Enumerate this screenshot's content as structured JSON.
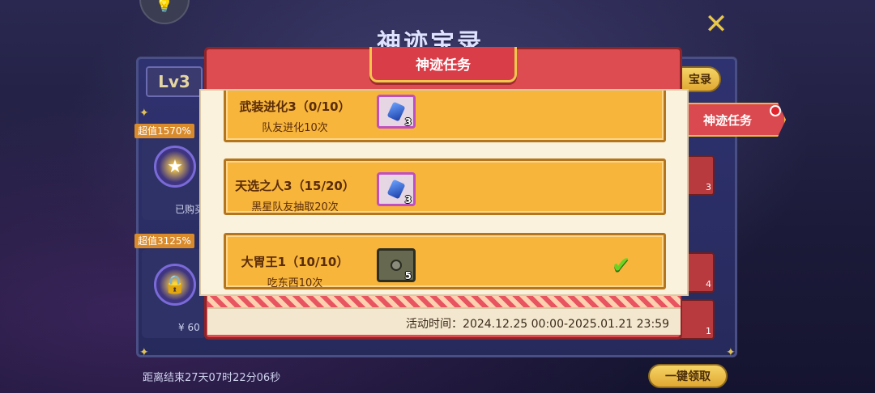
{
  "background": {
    "title": "神迹宝录",
    "level": "Lv3",
    "baolu_button": "宝录",
    "side_items": [
      {
        "badge": "超值1570%",
        "label": "已购买"
      },
      {
        "badge": "超值3125%",
        "label": "¥ 60"
      }
    ],
    "countdown": "距离结束27天07时22分06秒",
    "claim_all": "一键领取",
    "right_tab": "神迹任务",
    "right_slots": [
      "3",
      "4",
      "1"
    ]
  },
  "modal": {
    "title": "神迹任务",
    "tasks": [
      {
        "name": "武装进化3（0/10）",
        "desc": "队友进化10次",
        "reward_icon": "blue-gem-icon",
        "reward_count": "3",
        "completed": false
      },
      {
        "name": "天选之人3（15/20）",
        "desc": "黑星队友抽取20次",
        "reward_icon": "blue-gem-icon",
        "reward_count": "3",
        "completed": false
      },
      {
        "name": "大胃王1（10/10）",
        "desc": "吃东西10次",
        "reward_icon": "chest-icon",
        "reward_count": "5",
        "completed": true
      }
    ],
    "time_label": "活动时间：2024.12.25 00:00-2025.01.21 23:59"
  },
  "colors": {
    "modal_red": "#dd4c50",
    "card_orange": "#f7b53c",
    "text_brown": "#5a2c08",
    "check_green": "#6ad424"
  }
}
